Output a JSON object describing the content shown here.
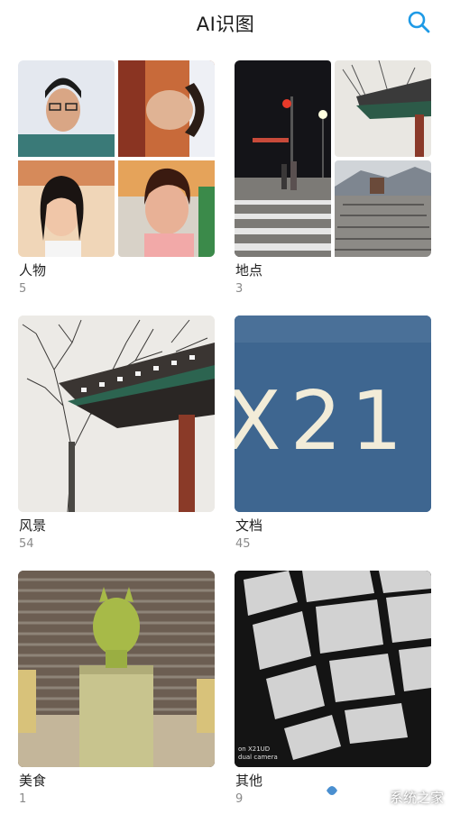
{
  "header": {
    "title": "AI识图",
    "search_icon": "search-icon",
    "accent_color": "#1e9ae6"
  },
  "categories": [
    {
      "label": "人物",
      "count": "5"
    },
    {
      "label": "地点",
      "count": "3"
    },
    {
      "label": "风景",
      "count": "54"
    },
    {
      "label": "文档",
      "count": "45"
    },
    {
      "label": "美食",
      "count": "1"
    },
    {
      "label": "其他",
      "count": "9"
    }
  ],
  "thumb_text": {
    "doc_text": "X21",
    "other_caption": "on X21UD\ndual camera"
  },
  "watermark": {
    "text": "系统之家",
    "url": "XITONGZHIJIA.NET"
  }
}
